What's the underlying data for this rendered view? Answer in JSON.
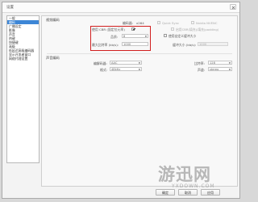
{
  "window": {
    "title": "设置"
  },
  "sidebar": {
    "items": [
      {
        "label": "一般",
        "selected": false
      },
      {
        "label": "编码",
        "selected": true
      },
      {
        "label": "广播设定",
        "selected": false
      },
      {
        "label": "影像",
        "selected": false
      },
      {
        "label": "声音",
        "selected": false
      },
      {
        "label": "热键",
        "selected": false
      },
      {
        "label": "快捷键",
        "selected": false
      },
      {
        "label": "高级",
        "selected": false
      },
      {
        "label": "低延迟高级编码器",
        "selected": false
      },
      {
        "label": "显示开发者窗口",
        "selected": false
      },
      {
        "label": "网络代理设置",
        "selected": false
      }
    ]
  },
  "video_encoding": {
    "title": "视频编码",
    "encoder_label": "编码器:",
    "encoder_value": "x264",
    "quicksync_label": "Quick Sync",
    "nvenc_label": "Nvidia NVENC",
    "cbr_label": "使用 CBR (固定位元率)",
    "cbr_checked": true,
    "padding_label": "启用CBR(填充)/填充(padding)",
    "quality_label": "品质:",
    "quality_value": "8",
    "custom_buffer_label": "使用自定义缓冲大小",
    "max_bitrate_label": "最大比特率 (kb/s):",
    "max_bitrate_value": "1000",
    "buffer_size_label": "缓冲大小 (kb/s):",
    "buffer_size_value": "1000"
  },
  "audio_encoding": {
    "title": "声音编码",
    "codec_label": "编解码器:",
    "codec_value": "AAC",
    "bitrate_label": "比特率:",
    "bitrate_value": "128",
    "format_label": "格式:",
    "format_value": "48kHz",
    "channel_label": "声道:",
    "channel_value": "stereo"
  },
  "buttons": {
    "ok": "确定",
    "cancel": "取消",
    "apply": "应用"
  },
  "watermark": {
    "cn": "游迅网",
    "en": "YXDOWN.COM"
  }
}
